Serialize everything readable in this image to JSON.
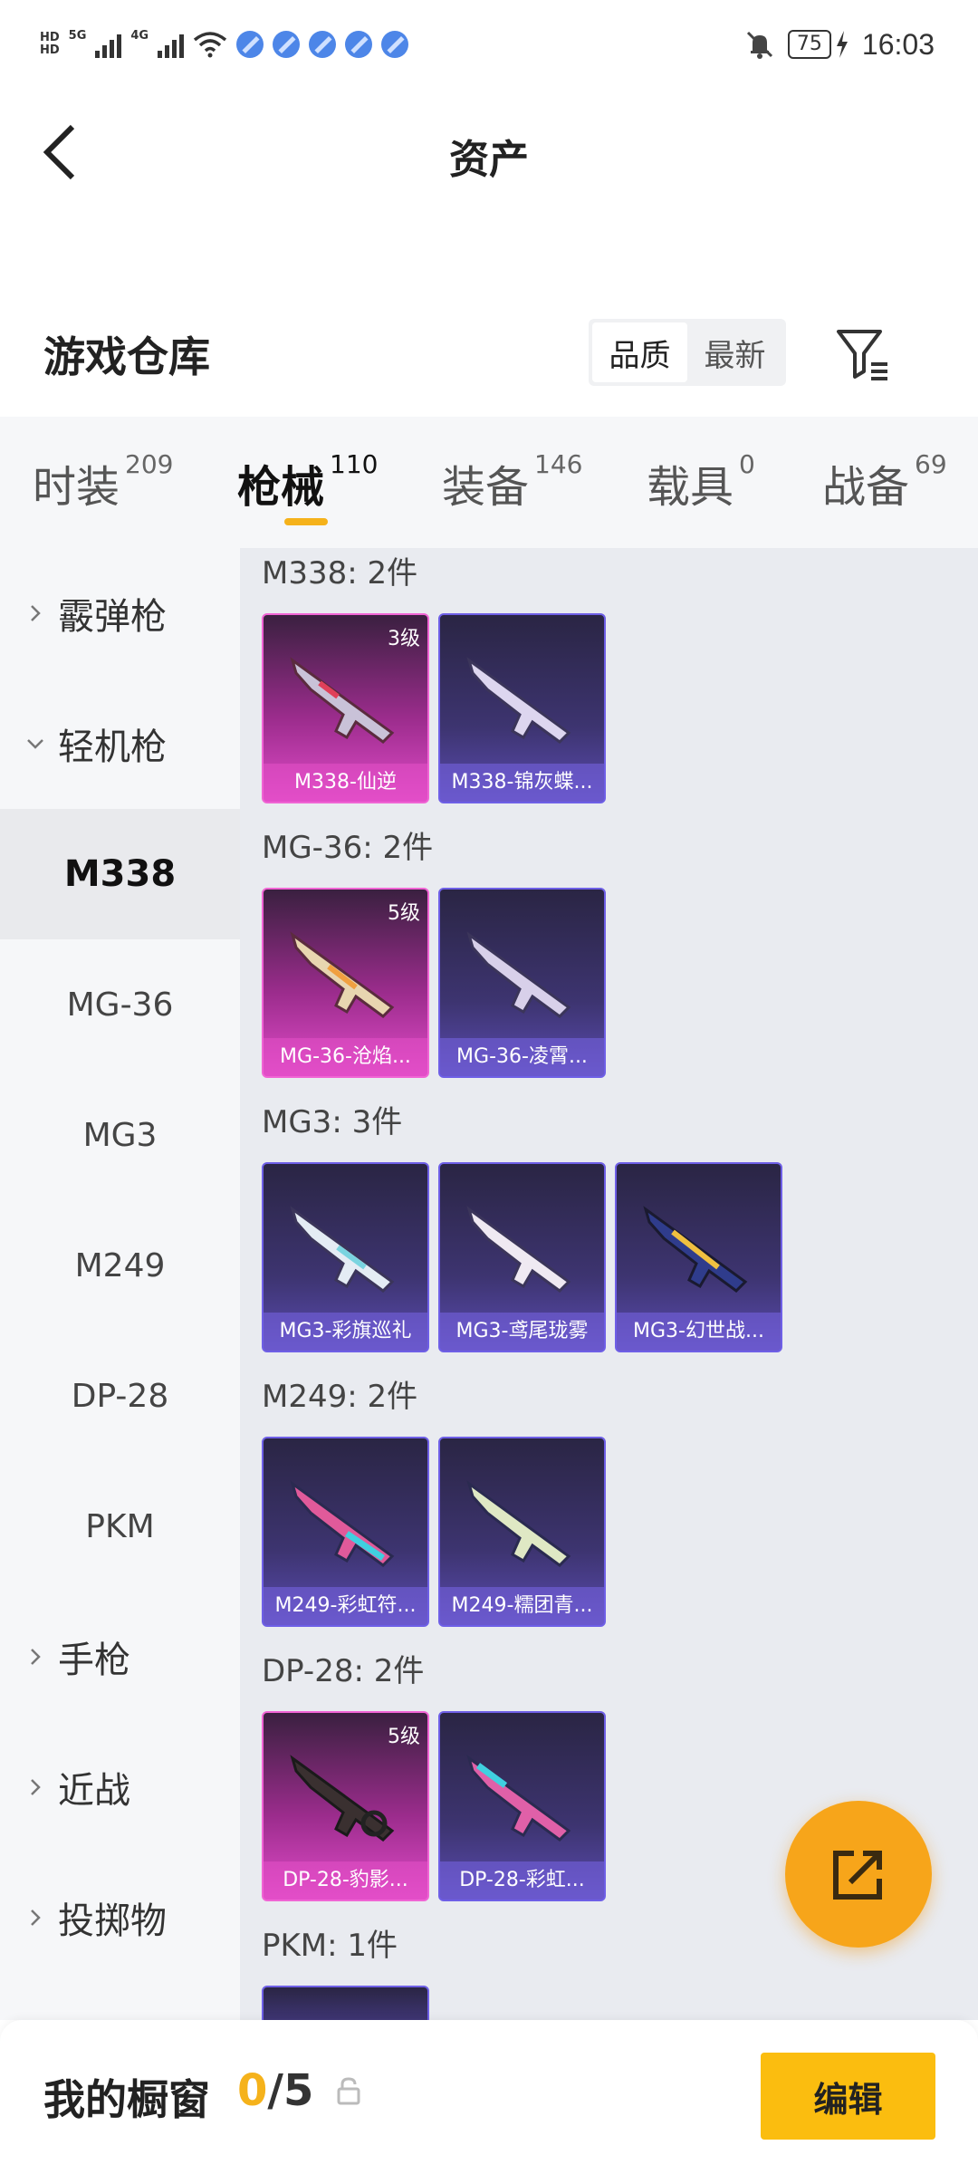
{
  "status_bar": {
    "hd_top": "HD",
    "hd_bottom": "HD",
    "network_1": "5G",
    "network_2": "4G",
    "battery": "75",
    "time": "16:03"
  },
  "header": {
    "title": "资产",
    "back_icon": "back-arrow-icon"
  },
  "warehouse": {
    "title": "游戏仓库",
    "sort_options": [
      "品质",
      "最新"
    ],
    "sort_selected": "品质"
  },
  "tabs": [
    {
      "label": "时装",
      "count": "209"
    },
    {
      "label": "枪械",
      "count": "110",
      "active": true
    },
    {
      "label": "装备",
      "count": "146"
    },
    {
      "label": "载具",
      "count": "0"
    },
    {
      "label": "战备",
      "count": "69"
    }
  ],
  "sidebar": {
    "groups": [
      {
        "label": "霰弹枪",
        "expanded": false
      },
      {
        "label": "轻机枪",
        "expanded": true
      },
      {
        "label": "手枪",
        "expanded": false
      },
      {
        "label": "近战",
        "expanded": false
      },
      {
        "label": "投掷物",
        "expanded": false
      }
    ],
    "sub_items": [
      "M338",
      "MG-36",
      "MG3",
      "M249",
      "DP-28",
      "PKM"
    ],
    "selected_sub": "M338"
  },
  "sections": [
    {
      "title": "M338: 2件",
      "items": [
        {
          "name": "M338-仙逆",
          "level": "3级",
          "rarity": "pink"
        },
        {
          "name": "M338-锦灰蝶...",
          "level": "",
          "rarity": "purple"
        }
      ]
    },
    {
      "title": "MG-36: 2件",
      "items": [
        {
          "name": "MG-36-沧焰...",
          "level": "5级",
          "rarity": "pink"
        },
        {
          "name": "MG-36-凌霄...",
          "level": "",
          "rarity": "purple"
        }
      ]
    },
    {
      "title": "MG3: 3件",
      "items": [
        {
          "name": "MG3-彩旗巡礼",
          "level": "",
          "rarity": "purple"
        },
        {
          "name": "MG3-鸢尾珑雾",
          "level": "",
          "rarity": "purple"
        },
        {
          "name": "MG3-幻世战...",
          "level": "",
          "rarity": "purple"
        }
      ]
    },
    {
      "title": "M249: 2件",
      "items": [
        {
          "name": "M249-彩虹符...",
          "level": "",
          "rarity": "purple"
        },
        {
          "name": "M249-糯团青...",
          "level": "",
          "rarity": "purple"
        }
      ]
    },
    {
      "title": "DP-28: 2件",
      "items": [
        {
          "name": "DP-28-豹影...",
          "level": "5级",
          "rarity": "pink"
        },
        {
          "name": "DP-28-彩虹...",
          "level": "",
          "rarity": "purple"
        }
      ]
    },
    {
      "title": "PKM: 1件",
      "items": []
    }
  ],
  "showcase": {
    "label": "我的橱窗",
    "current": "0",
    "separator": "/",
    "max": "5",
    "edit_label": "编辑"
  },
  "colors": {
    "accent": "#f5b21b",
    "purple_rarity": "#6e5fe6",
    "pink_rarity": "#e04bc8"
  }
}
